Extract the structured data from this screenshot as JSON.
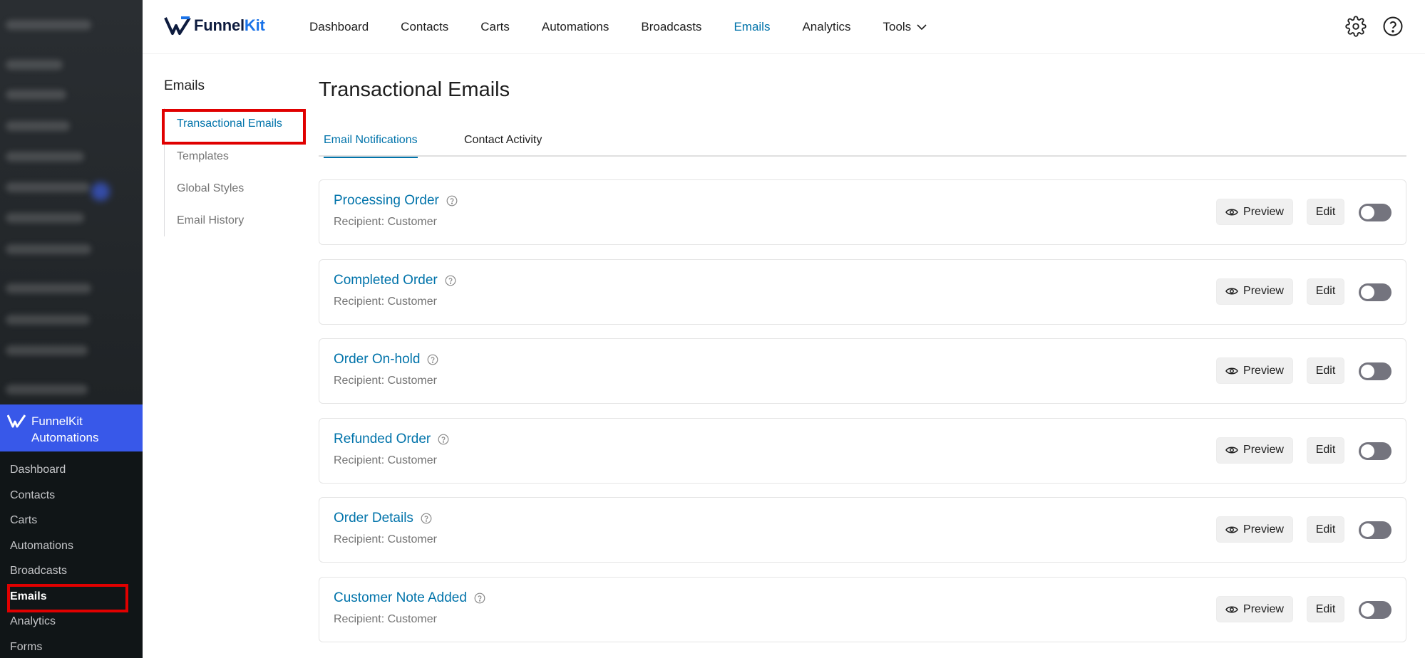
{
  "wp_sidebar": {
    "plugin_name": "FunnelKit Automations",
    "submenu": [
      {
        "label": "Dashboard"
      },
      {
        "label": "Contacts"
      },
      {
        "label": "Carts"
      },
      {
        "label": "Automations"
      },
      {
        "label": "Broadcasts"
      },
      {
        "label": "Emails",
        "current": true
      },
      {
        "label": "Analytics"
      },
      {
        "label": "Forms"
      }
    ]
  },
  "header": {
    "brand": {
      "part1": "Funnel",
      "part2": "Kit"
    },
    "nav": [
      {
        "label": "Dashboard"
      },
      {
        "label": "Contacts"
      },
      {
        "label": "Carts"
      },
      {
        "label": "Automations"
      },
      {
        "label": "Broadcasts"
      },
      {
        "label": "Emails",
        "active": true
      },
      {
        "label": "Analytics"
      },
      {
        "label": "Tools",
        "has_dropdown": true
      }
    ],
    "icons": [
      "gear-icon",
      "help-icon"
    ]
  },
  "submenu": {
    "title": "Emails",
    "items": [
      {
        "label": "Transactional Emails",
        "active": true
      },
      {
        "label": "Templates"
      },
      {
        "label": "Global Styles"
      },
      {
        "label": "Email History"
      }
    ]
  },
  "main": {
    "title": "Transactional Emails",
    "tabs": [
      {
        "label": "Email Notifications",
        "active": true
      },
      {
        "label": "Contact Activity"
      }
    ],
    "preview_label": "Preview",
    "edit_label": "Edit",
    "emails": [
      {
        "title": "Processing Order",
        "recipient": "Recipient: Customer",
        "enabled": false
      },
      {
        "title": "Completed Order",
        "recipient": "Recipient: Customer",
        "enabled": false
      },
      {
        "title": "Order On-hold",
        "recipient": "Recipient: Customer",
        "enabled": false
      },
      {
        "title": "Refunded Order",
        "recipient": "Recipient: Customer",
        "enabled": false
      },
      {
        "title": "Order Details",
        "recipient": "Recipient: Customer",
        "enabled": false
      },
      {
        "title": "Customer Note Added",
        "recipient": "Recipient: Customer",
        "enabled": false
      }
    ]
  },
  "colors": {
    "accent": "#0073aa",
    "plugin_active_bg": "#3858e9",
    "annotation": "#e00000",
    "toggle_off": "#74747e"
  }
}
